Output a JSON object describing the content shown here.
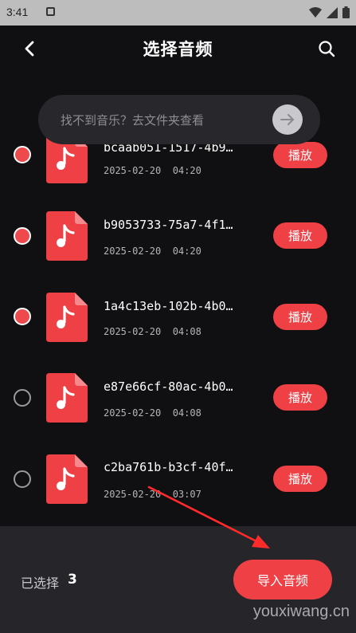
{
  "status_bar": {
    "time": "3:41"
  },
  "nav": {
    "title": "选择音频"
  },
  "hint": {
    "text": "找不到音乐？去文件夹查看"
  },
  "files": [
    {
      "name": "bcaab051-1517-4b9…",
      "date": "2025-02-20  04:20",
      "checked": true,
      "play_label": "播放"
    },
    {
      "name": "b9053733-75a7-4f1…",
      "date": "2025-02-20  04:20",
      "checked": true,
      "play_label": "播放"
    },
    {
      "name": "1a4c13eb-102b-4b0…",
      "date": "2025-02-20  04:08",
      "checked": true,
      "play_label": "播放"
    },
    {
      "name": "e87e66cf-80ac-4b0…",
      "date": "2025-02-20  04:08",
      "checked": false,
      "play_label": "播放"
    },
    {
      "name": "c2ba761b-b3cf-40f…",
      "date": "2025-02-20  03:07",
      "checked": false,
      "play_label": "播放"
    }
  ],
  "footer": {
    "selected_label": "已选择",
    "selected_count": "3",
    "import_label": "导入音频"
  },
  "watermark": "youxiwang.cn",
  "colors": {
    "accent": "#ee4045",
    "background": "#101012",
    "footer": "#25252a"
  },
  "icons": {
    "back": "chevron-left-icon",
    "search": "search-icon",
    "go": "arrow-right-icon",
    "file": "music-file-icon"
  }
}
